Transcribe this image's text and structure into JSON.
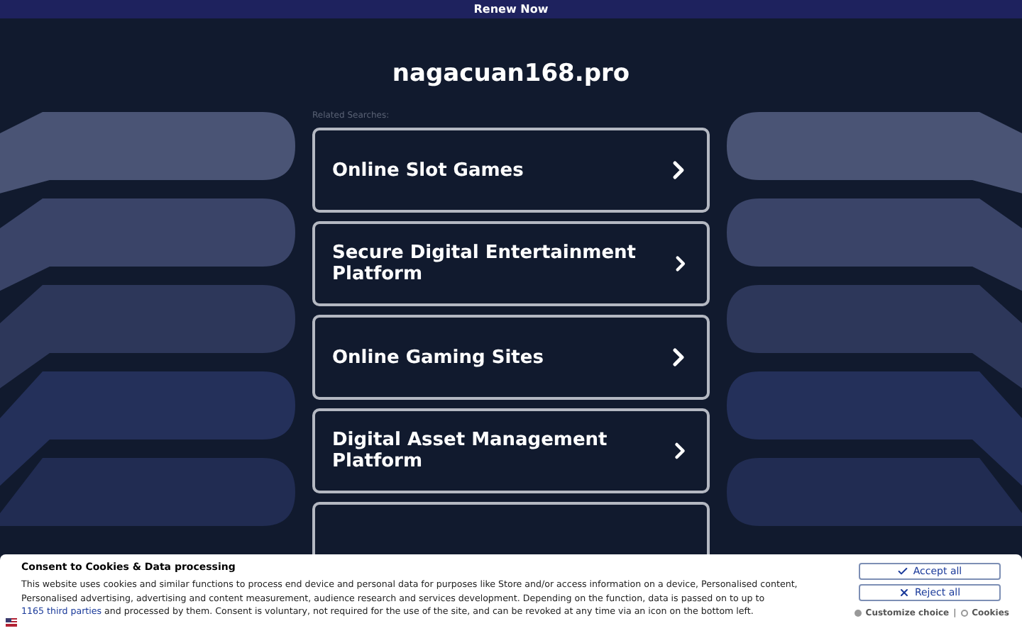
{
  "top_bar": {
    "link": "Renew Now"
  },
  "domain": "nagacuan168.pro",
  "related_label": "Related Searches:",
  "searches": [
    {
      "label": "Online Slot Games"
    },
    {
      "label": "Secure Digital Entertainment Platform"
    },
    {
      "label": "Online Gaming Sites"
    },
    {
      "label": "Digital Asset Management Platform"
    }
  ],
  "more_cards_below": true,
  "consent": {
    "title": "Consent to Cookies & Data processing",
    "text_before": "This website uses cookies and similar functions to process end device and personal data for purposes like Store and/or access information on a device, Personalised content, Personalised advertising, advertising and content measurement, audience research and services development. Depending on the function, data is passed on to up to ",
    "link": "1165 third parties",
    "text_after": " and processed by them. Consent is voluntary, not required for the use of the site, and can be revoked at any time via an icon on the bottom left.",
    "accept": "Accept all",
    "reject": "Reject all",
    "customize": "Customize choice",
    "separator": "|",
    "cookies": "Cookies"
  }
}
